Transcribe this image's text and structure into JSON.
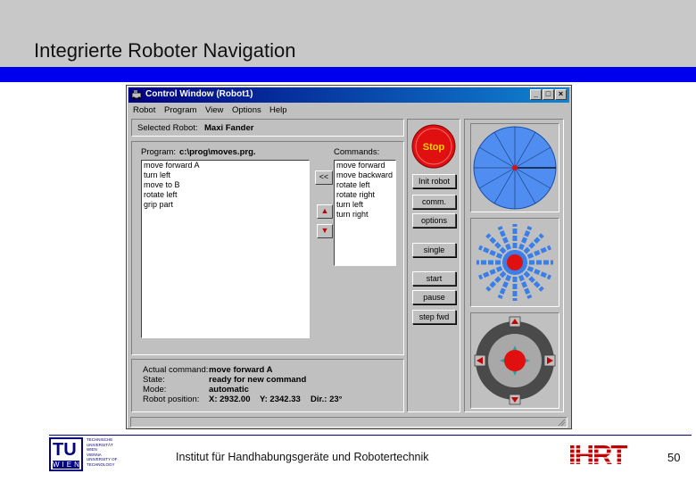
{
  "slide": {
    "title": "Integrierte Roboter Navigation",
    "footer": "Institut für Handhabungsgeräte und Robotertechnik",
    "page_number": "50",
    "logo_left_lines": [
      "TECHNISCHE",
      "UNIVERSITÄT",
      "WIEN",
      "VIENNA",
      "UNIVERSITY OF",
      "TECHNOLOGY"
    ],
    "logo_left_letters": "TU",
    "logo_left_sub": "WIEN",
    "logo_right": "IHRT"
  },
  "window": {
    "title": "Control Window (Robot1)",
    "menu": [
      "Robot",
      "Program",
      "View",
      "Options",
      "Help"
    ],
    "selected_robot_label": "Selected Robot:",
    "selected_robot_value": "Maxi Fander",
    "program_label": "Program:",
    "program_value": "c:\\prog\\moves.prg.",
    "commands_label": "Commands:",
    "program_lines": [
      "move forward A",
      "turn left",
      "move to B",
      "rotate left",
      "grip part"
    ],
    "commands": [
      "move forward",
      "move backward",
      "rotate left",
      "rotate right",
      "turn left",
      "turn right"
    ],
    "transfer_button": "<<",
    "up_arrow": "▲",
    "down_arrow": "▼",
    "stop_button": "Stop",
    "buttons": {
      "init_robot": "Init robot",
      "comm": "comm.",
      "options": "options",
      "single": "single",
      "start": "start",
      "pause": "pause",
      "step_fwd": "step fwd"
    },
    "status": {
      "actual_command_label": "Actual command:",
      "actual_command_value": "move forward A",
      "state_label": "State:",
      "state_value": "ready for new command",
      "mode_label": "Mode:",
      "mode_value": "automatic",
      "position_label": "Robot position:",
      "position_x": "X: 2932.00",
      "position_y": "Y: 2342.33",
      "position_dir": "Dir.: 23°"
    }
  },
  "colors": {
    "header_gray": "#c8c8c8",
    "header_blue": "#0000ee",
    "titlebar": "#000080",
    "stop_red": "#e01010",
    "sensor_blue": "#3a7fe8",
    "footer_logo_red": "#c00000"
  }
}
